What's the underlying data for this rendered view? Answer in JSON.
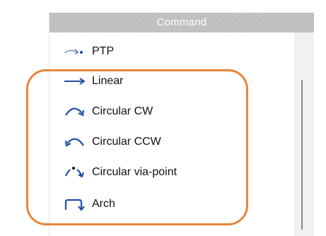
{
  "panel": {
    "title": "Command"
  },
  "items": [
    {
      "label": "PTP",
      "icon": "ptp-motion-icon"
    },
    {
      "label": "Linear",
      "icon": "linear-arrow-icon"
    },
    {
      "label": "Circular CW",
      "icon": "circular-cw-icon"
    },
    {
      "label": "Circular CCW",
      "icon": "circular-ccw-icon"
    },
    {
      "label": "Circular via-point",
      "icon": "circular-via-point-icon"
    },
    {
      "label": "Arch",
      "icon": "arch-icon"
    }
  ],
  "colors": {
    "icon_blue": "#1f4fa3",
    "header_gray": "#c2c2c2",
    "highlight_orange": "#e8853c"
  }
}
